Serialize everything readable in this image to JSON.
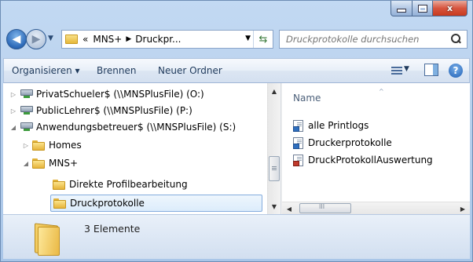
{
  "window": {
    "caption_buttons": {
      "minimize": "minimize",
      "maximize": "maximize",
      "close": "x"
    }
  },
  "nav": {
    "address": {
      "overflow": "«",
      "crumbs": [
        "MNS+",
        "Druckpr..."
      ]
    },
    "search": {
      "placeholder": "Druckprotokolle durchsuchen"
    }
  },
  "toolbar": {
    "organize_label": "Organisieren ▾",
    "burn_label": "Brennen",
    "new_folder_label": "Neuer Ordner"
  },
  "tree": {
    "items": [
      {
        "label": "PrivatSchueler$ (\\\\MNSPlusFile) (O:)",
        "type": "drive",
        "expanded": false
      },
      {
        "label": "PublicLehrer$ (\\\\MNSPlusFile) (P:)",
        "type": "drive",
        "expanded": false
      },
      {
        "label": "Anwendungsbetreuer$ (\\\\MNSPlusFile) (S:)",
        "type": "drive",
        "expanded": true
      },
      {
        "label": "Homes",
        "type": "folder",
        "expanded": false
      },
      {
        "label": "MNS+",
        "type": "folder",
        "expanded": true
      },
      {
        "label": "Direkte Profilbearbeitung",
        "type": "folder"
      },
      {
        "label": "Druckprotokolle",
        "type": "folder",
        "selected": true
      }
    ]
  },
  "content": {
    "column_header": "Name",
    "files": [
      {
        "label": "alle Printlogs",
        "icon": "shortcut-file-icon"
      },
      {
        "label": "Druckerprotokolle",
        "icon": "shortcut-file-icon"
      },
      {
        "label": "DruckProtokollAuswertung",
        "icon": "database-file-icon"
      }
    ],
    "hscroll_grip": "III"
  },
  "details": {
    "count_text": "3 Elemente"
  },
  "colors": {
    "accent": "#84acdd",
    "window_frame": "#bcd3ee",
    "close_button": "#c73a1e"
  }
}
